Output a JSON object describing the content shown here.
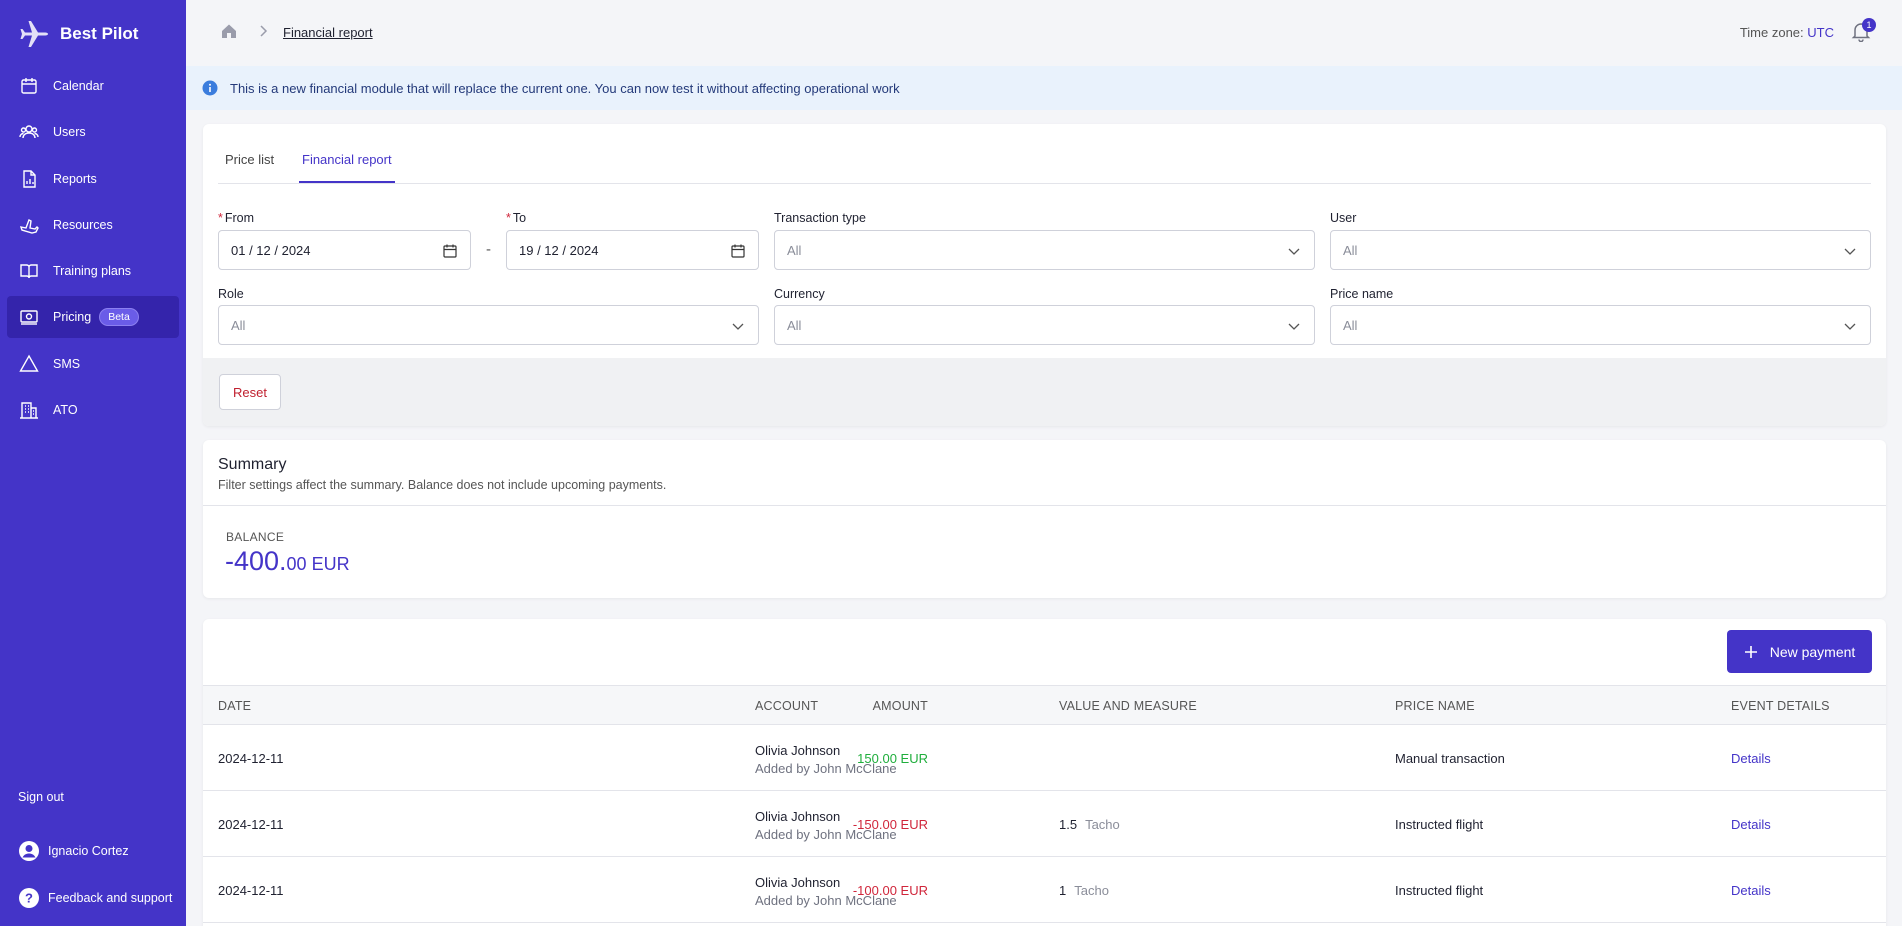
{
  "brand": {
    "name": "Best Pilot"
  },
  "sidebar": {
    "items": [
      {
        "label": "Calendar"
      },
      {
        "label": "Users"
      },
      {
        "label": "Reports"
      },
      {
        "label": "Resources"
      },
      {
        "label": "Training plans"
      },
      {
        "label": "Pricing",
        "badge": "Beta"
      },
      {
        "label": "SMS"
      },
      {
        "label": "ATO"
      }
    ],
    "footer": {
      "sign_out": "Sign out",
      "user_name": "Ignacio Cortez",
      "feedback": "Feedback and support"
    }
  },
  "header": {
    "breadcrumb": "Financial report",
    "timezone_label": "Time zone:",
    "timezone_value": "UTC",
    "notifications_count": "1"
  },
  "info_banner": "This is a new financial module that will replace the current one. You can now test it without affecting operational work",
  "tabs": [
    {
      "label": "Price list"
    },
    {
      "label": "Financial report"
    }
  ],
  "filters": {
    "from_label": "From",
    "from_value": "01 / 12 / 2024",
    "to_label": "To",
    "to_value": "19 / 12 / 2024",
    "separator": "-",
    "transaction_type_label": "Transaction type",
    "transaction_type_value": "All",
    "user_label": "User",
    "user_value": "All",
    "role_label": "Role",
    "role_value": "All",
    "currency_label": "Currency",
    "currency_value": "All",
    "price_name_label": "Price name",
    "price_name_value": "All",
    "reset": "Reset"
  },
  "summary": {
    "title": "Summary",
    "subtitle": "Filter settings affect the summary. Balance does not include upcoming payments.",
    "balance_label": "BALANCE",
    "balance_int": "-400.",
    "balance_dec": "00 EUR"
  },
  "table": {
    "new_payment": "New payment",
    "headers": {
      "date": "DATE",
      "amount": "AMOUNT",
      "account": "ACCOUNT",
      "value_measure": "VALUE AND MEASURE",
      "price_name": "PRICE NAME",
      "event_details": "EVENT DETAILS"
    },
    "rows": [
      {
        "date": "2024-12-11",
        "amount": "150.00 EUR",
        "account": "Olivia Johnson",
        "added_by": "Added by John McClane",
        "value": "",
        "measure": "",
        "price_name": "Manual transaction",
        "details": "Details"
      },
      {
        "date": "2024-12-11",
        "amount": "-150.00 EUR",
        "account": "Olivia Johnson",
        "added_by": "Added by John McClane",
        "value": "1.5",
        "measure": "Tacho",
        "price_name": "Instructed flight",
        "details": "Details"
      },
      {
        "date": "2024-12-11",
        "amount": "-100.00 EUR",
        "account": "Olivia Johnson",
        "added_by": "Added by John McClane",
        "value": "1",
        "measure": "Tacho",
        "price_name": "Instructed flight",
        "details": "Details"
      }
    ]
  },
  "colors": {
    "sidebar": "#4434c8",
    "accent": "#4434c8",
    "positive": "#1fae3c",
    "negative": "#d0263b"
  },
  "icons": [
    "plane-logo-icon",
    "calendar-icon",
    "users-icon",
    "reports-icon",
    "resources-icon",
    "book-icon",
    "pricing-icon",
    "warning-icon",
    "building-icon",
    "avatar-icon",
    "help-icon",
    "home-icon",
    "chevron-right-icon",
    "bell-icon",
    "info-icon",
    "chevron-down-icon",
    "plus-icon"
  ]
}
